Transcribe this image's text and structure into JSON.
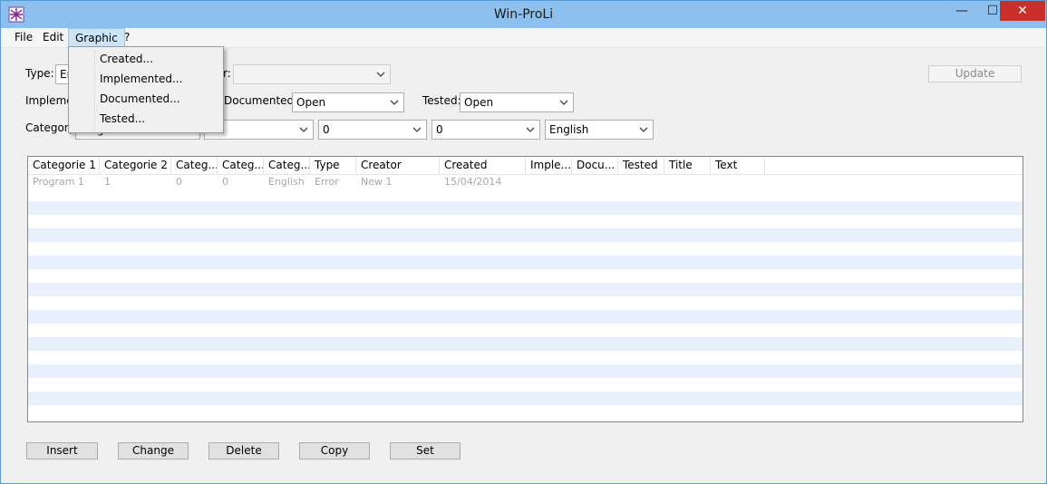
{
  "window": {
    "title": "Win-ProLi",
    "minimize_glyph": "—",
    "maximize_glyph": "☐",
    "close_glyph": "✕"
  },
  "menu": {
    "items": [
      "File",
      "Edit",
      "Graphic",
      "?"
    ],
    "active": "Graphic",
    "graphic_dropdown": [
      "Created...",
      "Implemented...",
      "Documented...",
      "Tested..."
    ]
  },
  "filters": {
    "type_label": "Type:",
    "type_value": "Er",
    "second_label": "r:",
    "second_value": "",
    "update_button": "Update",
    "implemented_label": "Impleme",
    "documented_label": "Documented:",
    "documented_value": "Open",
    "tested_label": "Tested:",
    "tested_value": "Open",
    "category_label": "Category",
    "category_values": [
      "Program 1",
      "1",
      "0",
      "0",
      "English"
    ]
  },
  "table": {
    "columns": [
      "Categorie 1",
      "Categorie 2",
      "Categ...",
      "Categ...",
      "Categ...",
      "Type",
      "Creator",
      "Created",
      "Imple...",
      "Docu...",
      "Tested",
      "Title",
      "Text"
    ],
    "rows": [
      [
        "Program 1",
        "1",
        "0",
        "0",
        "English",
        "Error",
        "New 1",
        "15/04/2014",
        "",
        "",
        "",
        "",
        ""
      ]
    ]
  },
  "buttons": {
    "insert": "Insert",
    "change": "Change",
    "delete": "Delete",
    "copy": "Copy",
    "set": "Set"
  },
  "colors": {
    "titlebar": "#8dc0ee",
    "close": "#c9302c",
    "stripe": "#e8f0fb",
    "menu_active": "#cce4f7"
  }
}
